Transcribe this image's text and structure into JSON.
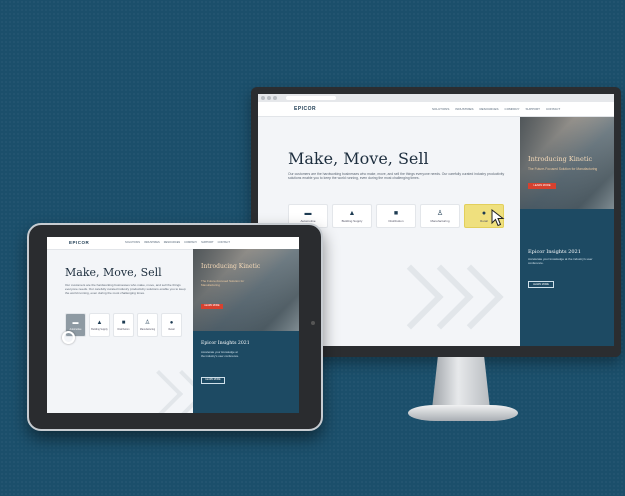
{
  "site": {
    "logo": "EPICOR",
    "nav_links": [
      "SOLUTIONS",
      "INDUSTRIES",
      "RESOURCES",
      "COMPANY",
      "SUPPORT",
      "CONTACT"
    ],
    "hero_title": "Make, Move, Sell",
    "hero_text": "Our customers are the hardworking businesses who make, move, and sell the things everyone needs. Our carefully curated industry productivity solutions enable you to keep the world running, even during the most challenging times.",
    "tiles": [
      {
        "icon": "factory-icon",
        "label": "Automotive"
      },
      {
        "icon": "building-icon",
        "label": "Building Supply"
      },
      {
        "icon": "truck-icon",
        "label": "Distribution"
      },
      {
        "icon": "worker-icon",
        "label": "Manufacturing"
      },
      {
        "icon": "basket-icon",
        "label": "Retail"
      }
    ],
    "promo": {
      "heading": "Introducing Kinetic",
      "subtitle": "The Future-Focused Solution for Manufacturing",
      "button": "LEARN MORE"
    },
    "insights": {
      "heading": "Epicor Insights 2021",
      "text": "Accelerate your knowledge at the industry's user conference.",
      "button": "LEARN MORE"
    }
  },
  "colors": {
    "background": "#1b4f6b",
    "accent_red": "#d6412f",
    "active_tile": "#efe07e",
    "promo_dark": "#1d4a63"
  }
}
